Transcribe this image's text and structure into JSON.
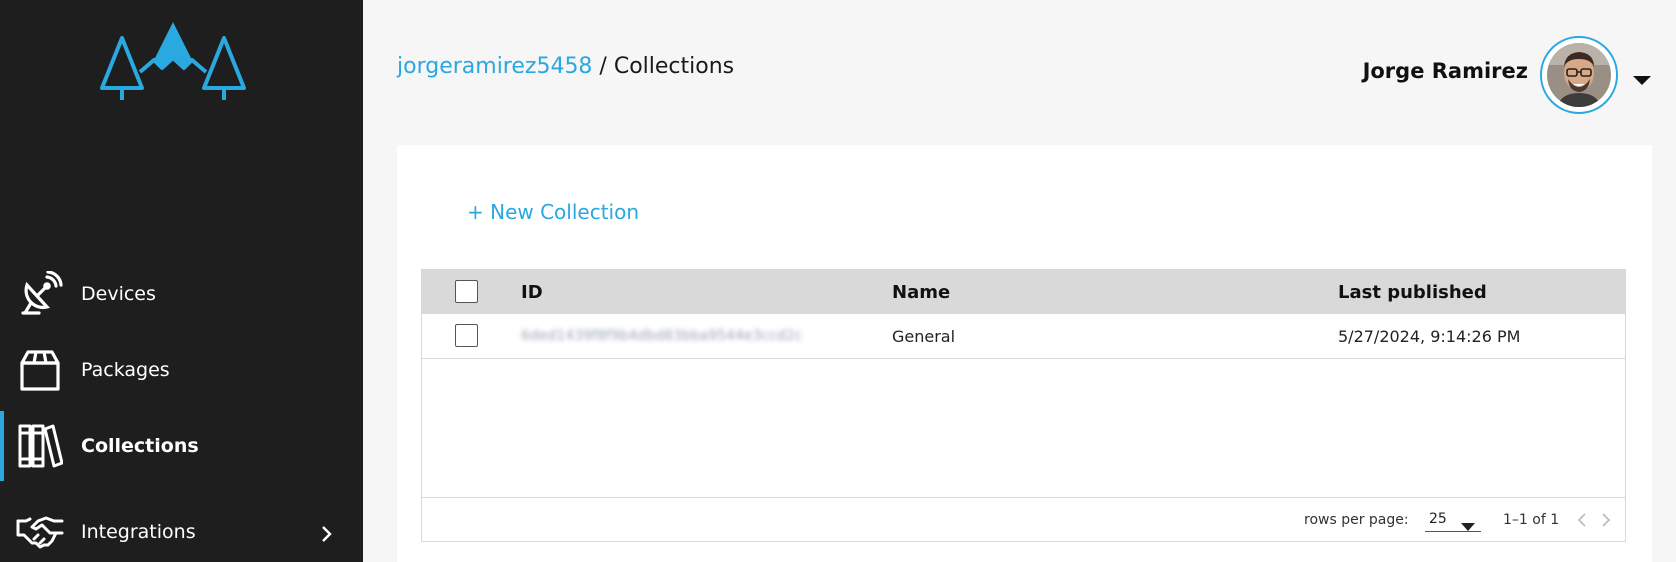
{
  "brand": {
    "accent": "#2aa8e0",
    "sidebar_bg": "#1e1e1e",
    "logo_icon": "mountains-trees-logo"
  },
  "sidebar": {
    "items": [
      {
        "label": "Devices",
        "icon": "satellite-dish-icon",
        "active": false
      },
      {
        "label": "Packages",
        "icon": "box-icon",
        "active": false
      },
      {
        "label": "Collections",
        "icon": "books-icon",
        "active": true
      },
      {
        "label": "Integrations",
        "icon": "handshake-icon",
        "active": false,
        "has_submenu": true
      }
    ]
  },
  "header": {
    "breadcrumb": {
      "link": "jorgeramirez5458",
      "separator": " / ",
      "current": "Collections"
    },
    "user_name": "Jorge Ramirez"
  },
  "main": {
    "new_collection_label": "+ New Collection",
    "table": {
      "columns": [
        "ID",
        "Name",
        "Last published"
      ],
      "rows": [
        {
          "id": "6ded1439f8f9b4dbd83bba9544e3ccd2c",
          "name": "General",
          "last_published": "5/27/2024, 9:14:26 PM"
        }
      ]
    },
    "pagination": {
      "rows_per_page_label": "rows per page:",
      "rows_per_page": "25",
      "range": "1–1 of 1"
    }
  }
}
